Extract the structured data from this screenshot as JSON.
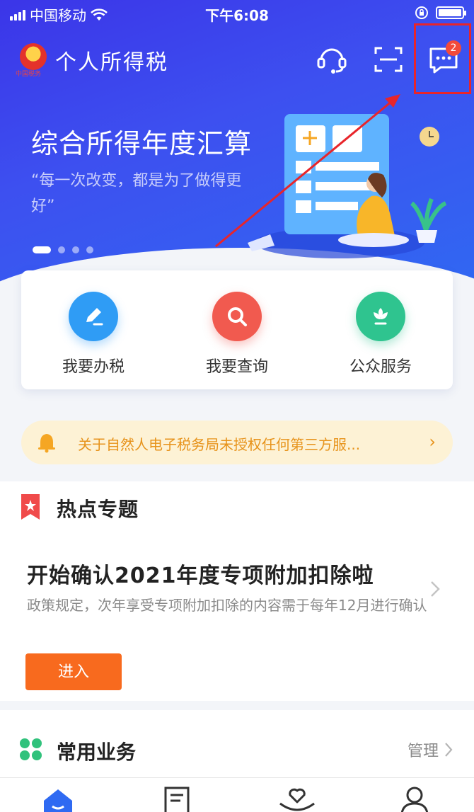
{
  "status_bar": {
    "carrier": "中国移动",
    "time": "下午6:08"
  },
  "header": {
    "app_title": "个人所得税",
    "emblem_subtext": "中国税务",
    "icons": [
      "headset-icon",
      "scan-icon",
      "message-icon"
    ],
    "message_badge": "2"
  },
  "banner": {
    "title": "综合所得年度汇算",
    "quote": "“每一次改变，都是为了做得更好”",
    "slide_count": 4,
    "active_slide": 1
  },
  "quick_actions": [
    {
      "label": "我要办税",
      "icon": "pencil-icon",
      "color": "#2f9cf5"
    },
    {
      "label": "我要查询",
      "icon": "magnifier-icon",
      "color": "#f15a4f"
    },
    {
      "label": "公众服务",
      "icon": "flower-icon",
      "color": "#2fc48f"
    }
  ],
  "notice": {
    "text": "关于自然人电子税务局未授权任何第三方服...",
    "icon": "bell-icon"
  },
  "hot_topics": {
    "section_title": "热点专题",
    "icon": "bookmark-star-icon",
    "topic_title": "开始确认2021年度专项附加扣除啦",
    "topic_desc": "政策规定，次年享受专项附加扣除的内容需于每年12月进行确认",
    "button_label": "进入"
  },
  "common_services": {
    "section_title": "常用业务",
    "manage_label": "管理",
    "icon": "clover-icon"
  },
  "tabbar": {
    "icons": [
      "home-icon",
      "document-icon",
      "heart-hand-icon",
      "person-icon"
    ],
    "active_index": 0
  },
  "colors": {
    "hero_blue": "#3b45ec",
    "accent_orange": "#f86a1e",
    "notice_text": "#e7931b",
    "highlight_red": "#e8252b"
  }
}
